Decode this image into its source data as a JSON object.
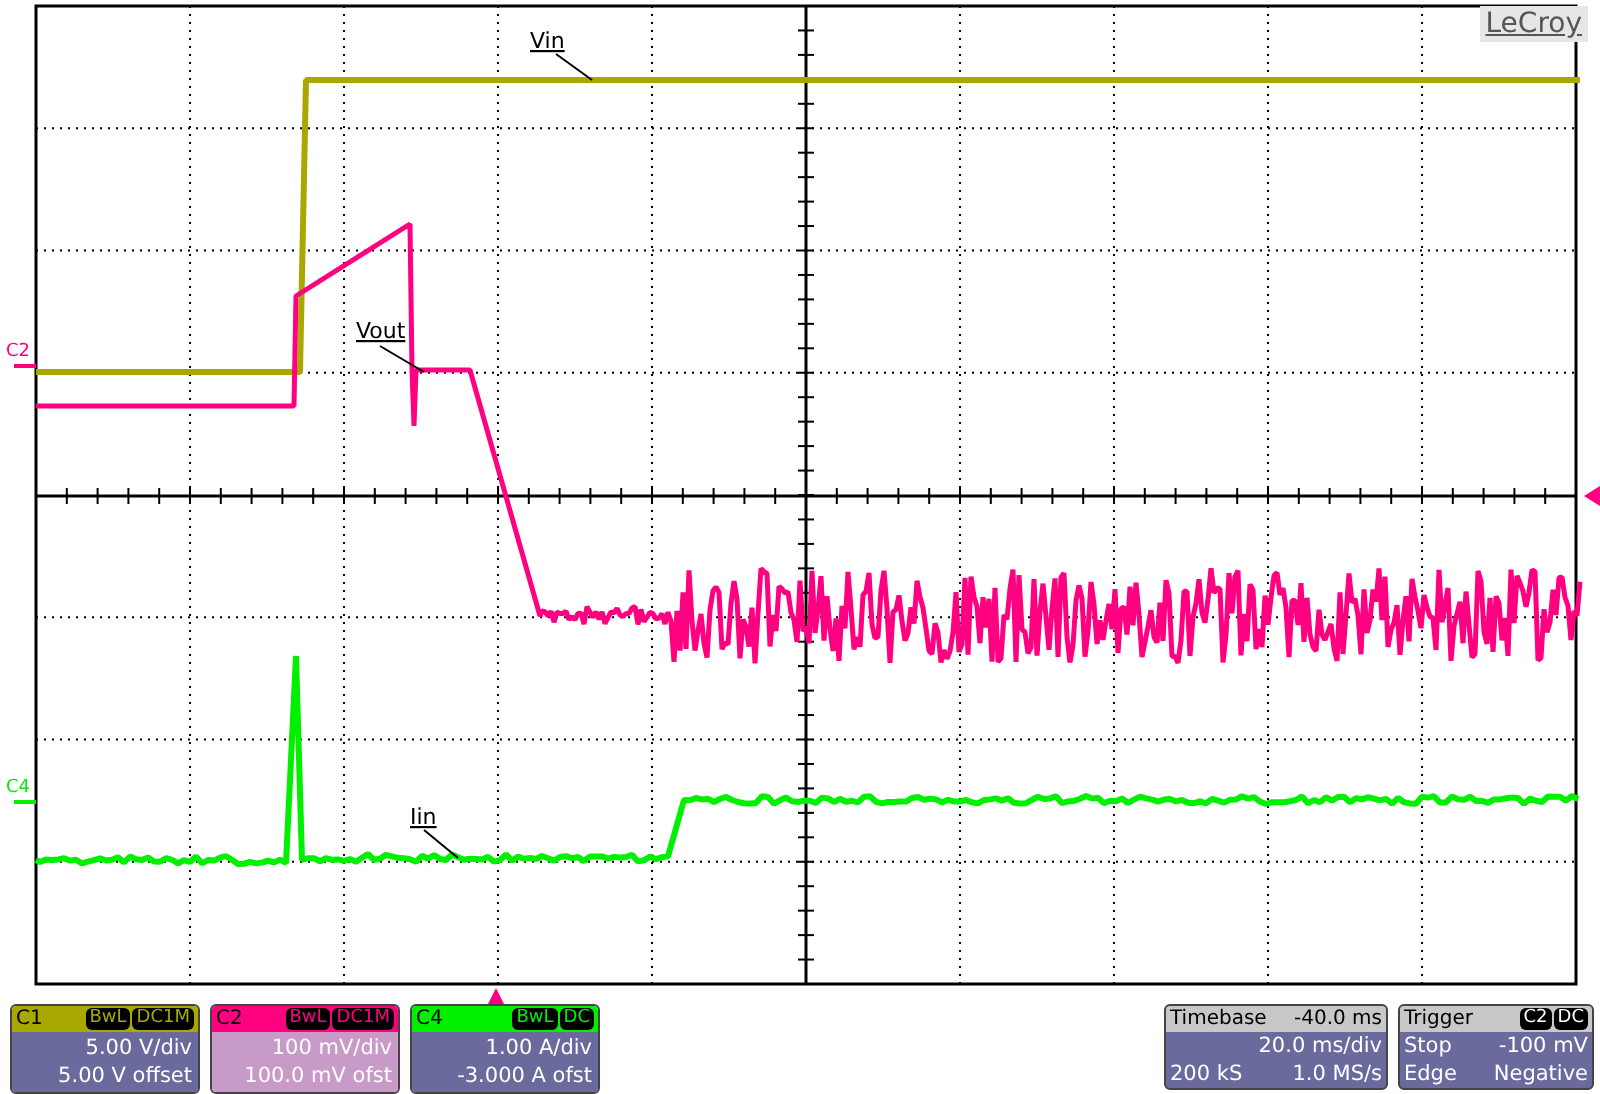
{
  "logo": "LeCroy",
  "traces": [
    {
      "label": "Vin",
      "color": "#a8a800"
    },
    {
      "label": "Vout",
      "color": "#ff0080"
    },
    {
      "label": "Iin",
      "color": "#00f000"
    }
  ],
  "channel_markers": [
    {
      "label": "C2",
      "color": "#ff0080"
    },
    {
      "label": "C4",
      "color": "#00f000"
    }
  ],
  "channels": [
    {
      "name": "C1",
      "bandwidth": "BwL",
      "coupling": "DC1M",
      "scale": "5.00 V/div",
      "offset": "5.00 V offset",
      "color": "#a8a800",
      "selected": false
    },
    {
      "name": "C2",
      "bandwidth": "BwL",
      "coupling": "DC1M",
      "scale": "100 mV/div",
      "offset": "100.0 mV ofst",
      "color": "#ff0080",
      "selected": true
    },
    {
      "name": "C4",
      "bandwidth": "BwL",
      "coupling": "DC",
      "scale": "1.00 A/div",
      "offset": "-3.000 A ofst",
      "color": "#00f000",
      "selected": false
    }
  ],
  "timebase": {
    "title": "Timebase",
    "delay": "-40.0 ms",
    "scale": "20.0 ms/div",
    "samples": "200 kS",
    "rate": "1.0 MS/s"
  },
  "trigger": {
    "title": "Trigger",
    "source": "C2",
    "coupling": "DC",
    "mode": "Stop",
    "threshold": "-100 mV",
    "type": "Edge",
    "slope": "Negative"
  }
}
